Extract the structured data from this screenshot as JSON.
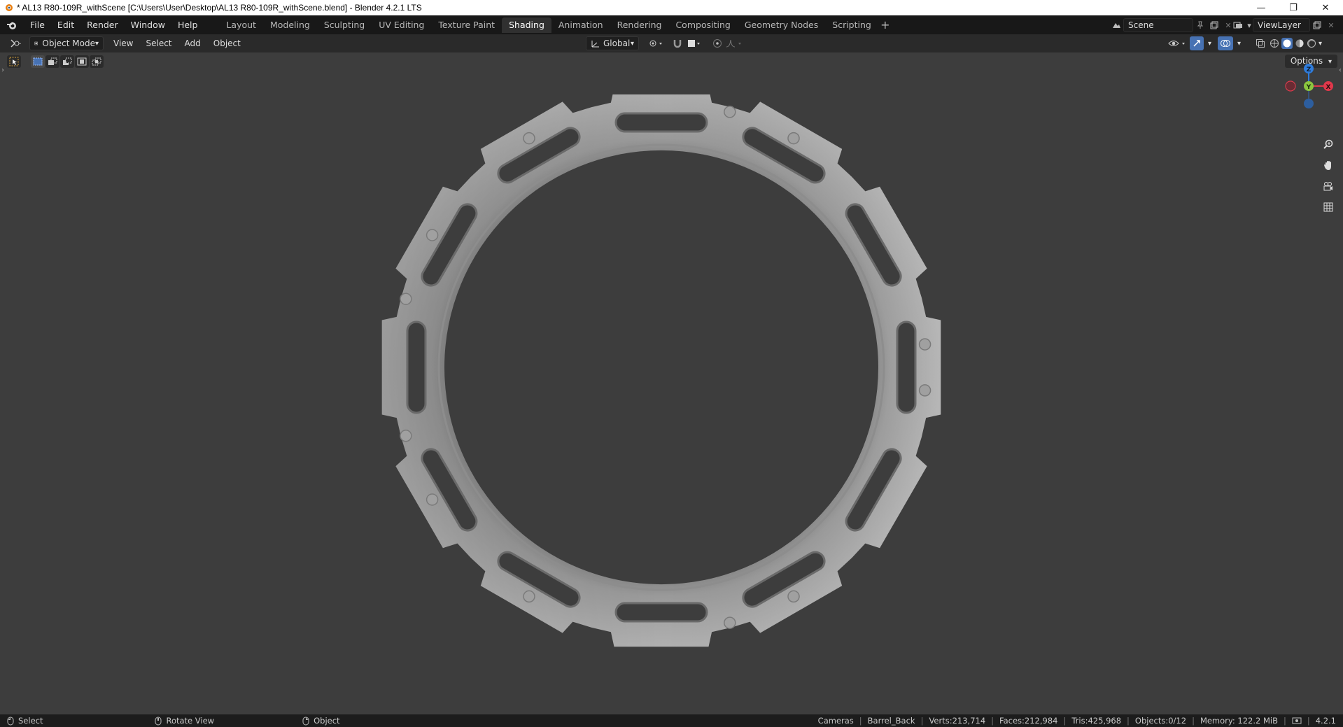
{
  "window": {
    "title": "* AL13 R80-109R_withScene [C:\\Users\\User\\Desktop\\AL13 R80-109R_withScene.blend] - Blender 4.2.1 LTS",
    "minimize": "—",
    "restore": "❐",
    "close": "✕"
  },
  "menu": [
    "File",
    "Edit",
    "Render",
    "Window",
    "Help"
  ],
  "workspaces": {
    "tabs": [
      "Layout",
      "Modeling",
      "Sculpting",
      "UV Editing",
      "Texture Paint",
      "Shading",
      "Animation",
      "Rendering",
      "Compositing",
      "Geometry Nodes",
      "Scripting"
    ],
    "active": "Shading",
    "add": "+"
  },
  "scene": {
    "name": "Scene",
    "view_layer": "ViewLayer"
  },
  "viewport_header": {
    "mode": "Object Mode",
    "menus": [
      "View",
      "Select",
      "Add",
      "Object"
    ],
    "transform_orientation": "Global"
  },
  "viewport": {
    "options_label": "Options",
    "gizmo": {
      "z": "Z",
      "y": "Y",
      "x": "X"
    },
    "colors": {
      "x_axis": "#e0384b",
      "y_axis": "#8cc63f",
      "z_axis": "#2f7cdb",
      "mesh": "#a6a6a6"
    }
  },
  "statusbar": {
    "select": "Select",
    "rotate_view": "Rotate View",
    "object": "Object",
    "stats": [
      "Cameras",
      "Barrel_Back",
      "Verts:213,714",
      "Faces:212,984",
      "Tris:425,968",
      "Objects:0/12",
      "Memory: 122.2 MiB"
    ],
    "version": "4.2.1"
  }
}
